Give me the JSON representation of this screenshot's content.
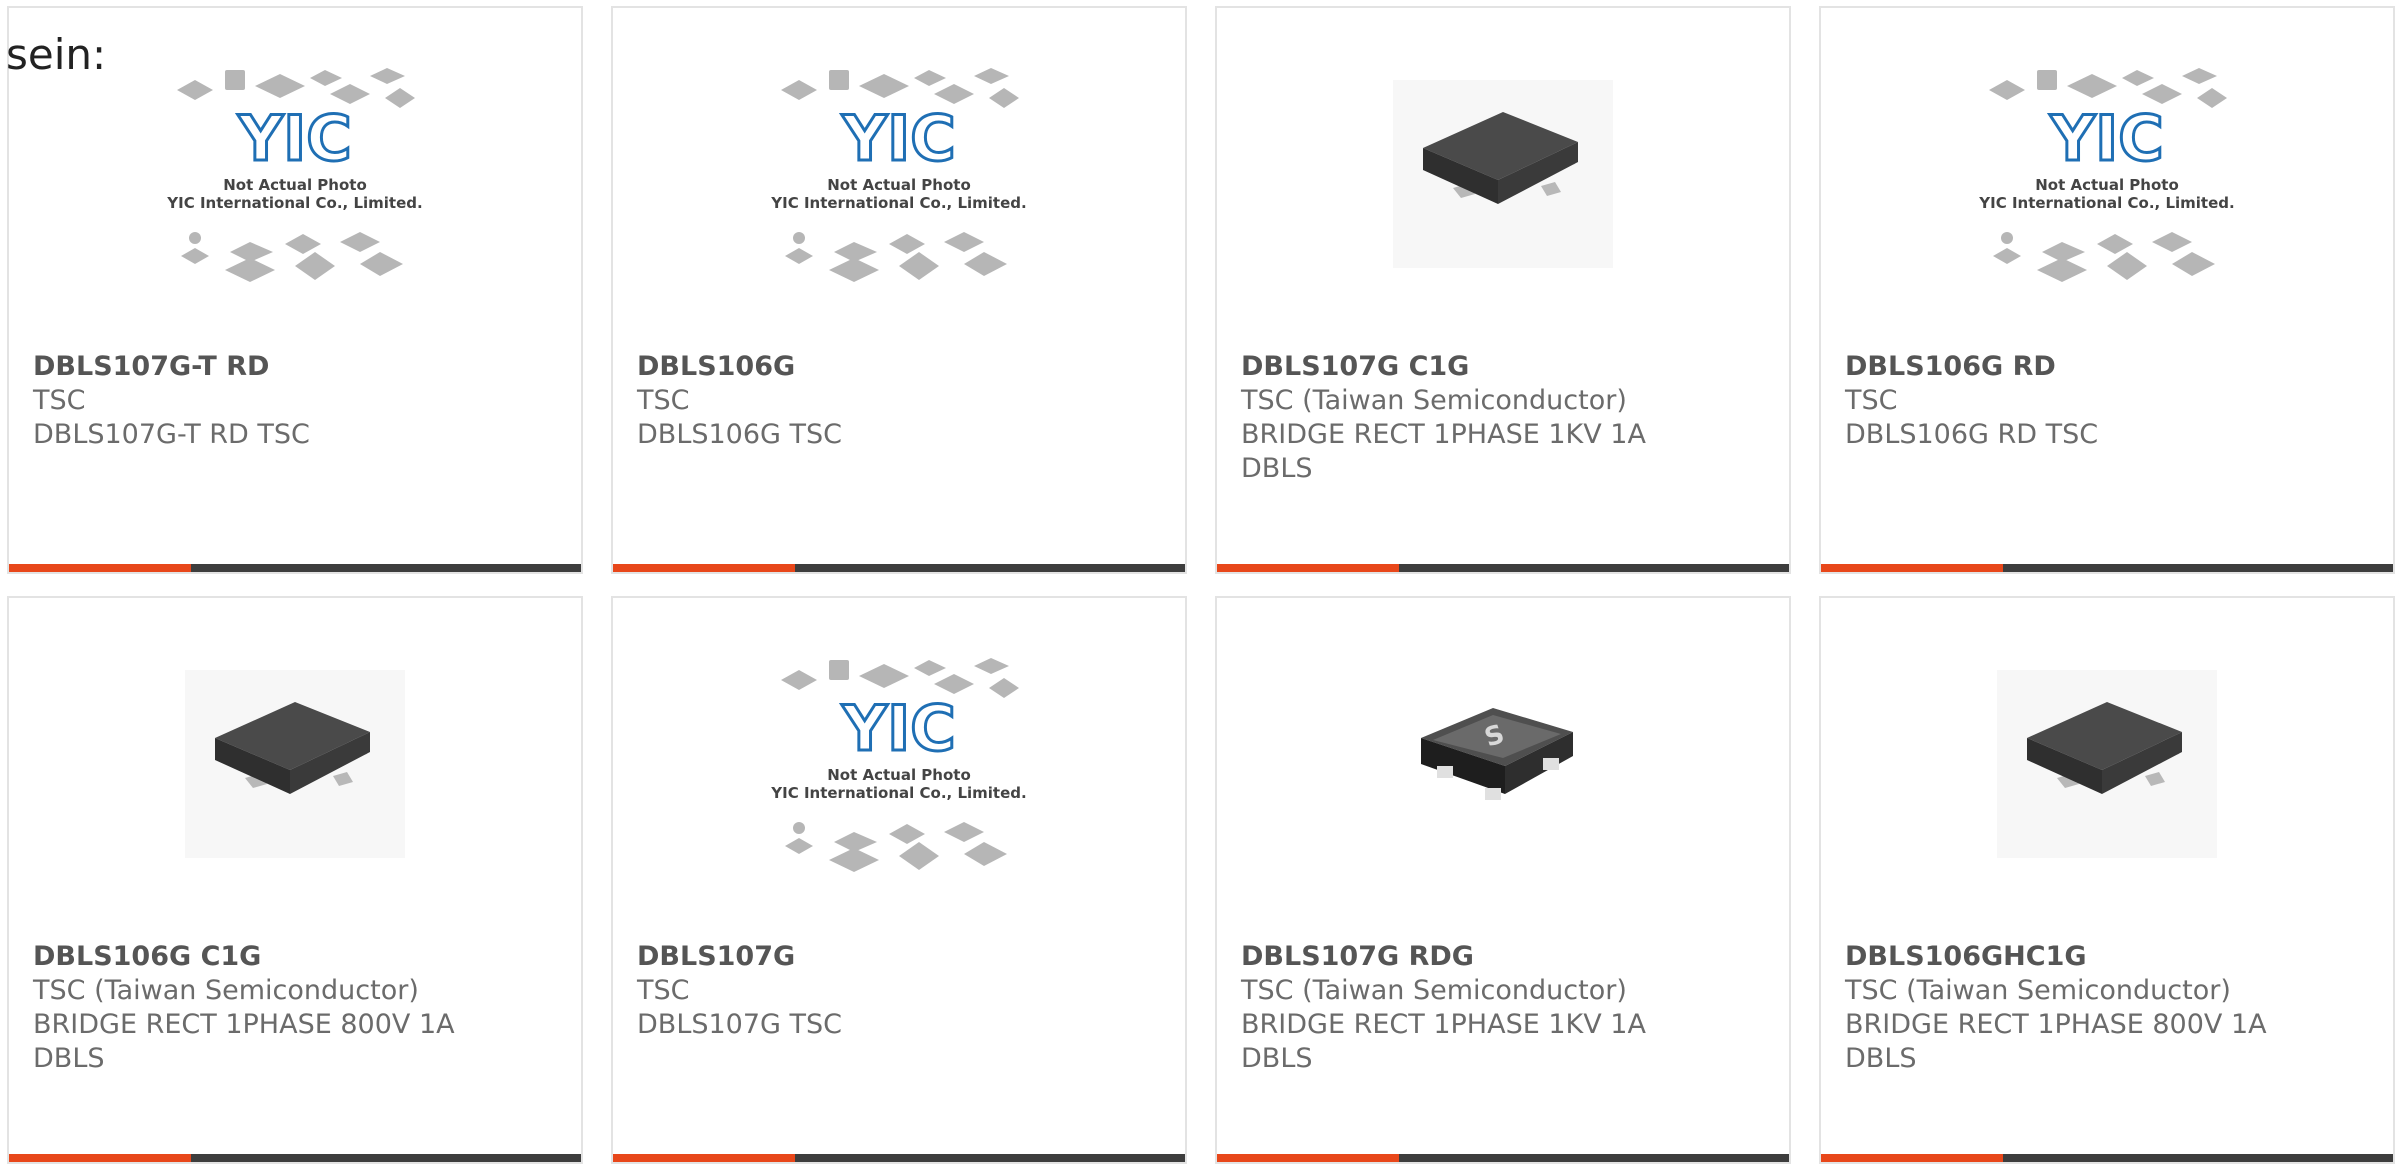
{
  "intro_text": "sein:",
  "colors": {
    "accent": "#e8471a",
    "bar": "#3d3d3d",
    "logo_blue": "#1f6fb4",
    "border": "#e3e3e3"
  },
  "placeholder": {
    "line1": "Not Actual Photo",
    "line2": "YIC International Co., Limited.",
    "logo": "YIC"
  },
  "products": [
    {
      "pn": "DBLS107G-T RD",
      "line1": "TSC",
      "line2": "DBLS107G-T RD TSC",
      "line3": "",
      "image": "placeholder-logo"
    },
    {
      "pn": "DBLS106G",
      "line1": "TSC",
      "line2": "DBLS106G TSC",
      "line3": "",
      "image": "placeholder-logo"
    },
    {
      "pn": "DBLS107G C1G",
      "line1": "TSC (Taiwan Semiconductor)",
      "line2": "BRIDGE RECT 1PHASE 1KV 1A",
      "line3": "DBLS",
      "image": "chip-photo"
    },
    {
      "pn": "DBLS106G RD",
      "line1": "TSC",
      "line2": "DBLS106G RD TSC",
      "line3": "",
      "image": "placeholder-logo"
    },
    {
      "pn": "DBLS106G C1G",
      "line1": "TSC (Taiwan Semiconductor)",
      "line2": "BRIDGE RECT 1PHASE 800V 1A",
      "line3": "DBLS",
      "image": "chip-photo"
    },
    {
      "pn": "DBLS107G",
      "line1": "TSC",
      "line2": "DBLS107G TSC",
      "line3": "",
      "image": "placeholder-logo"
    },
    {
      "pn": "DBLS107G RDG",
      "line1": "TSC (Taiwan Semiconductor)",
      "line2": "BRIDGE RECT 1PHASE 1KV 1A",
      "line3": "DBLS",
      "image": "chip-photo-marked"
    },
    {
      "pn": "DBLS106GHC1G",
      "line1": "TSC (Taiwan Semiconductor)",
      "line2": "BRIDGE RECT 1PHASE 800V 1A",
      "line3": "DBLS",
      "image": "chip-photo"
    }
  ]
}
